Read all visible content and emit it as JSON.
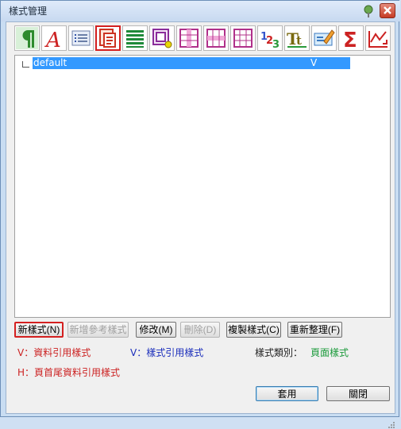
{
  "window": {
    "title": "樣式管理"
  },
  "colors": {
    "red": "#cc2222",
    "blue": "#1a2dbb",
    "green": "#1a9a3a",
    "selection": "#3399ff"
  },
  "toolbar": {
    "icons": [
      "pilcrow-icon",
      "text-style-icon",
      "list-style-icon",
      "page-style-icon",
      "rows-style-icon",
      "frame-style-icon",
      "column-style-icon",
      "row-band-icon",
      "grid-style-icon",
      "number-style-icon",
      "font-style-icon",
      "edit-style-icon",
      "sum-style-icon",
      "chart-style-icon"
    ],
    "selected_index": 3
  },
  "tree": {
    "item_name": "default",
    "item_flag": "V"
  },
  "buttons": {
    "new_style": "新樣式(N)",
    "new_ref_style": "新增參考樣式",
    "modify": "修改(M)",
    "delete": "刪除(D)",
    "copy_style": "複製樣式(C)",
    "reorganize": "重新整理(F)",
    "apply": "套用",
    "close": "關閉"
  },
  "legend": {
    "data_ref": "V：資料引用樣式",
    "style_ref": "V：樣式引用樣式",
    "category_label": "樣式類別：",
    "category_value": "頁面樣式",
    "header_ref": "H：頁首尾資料引用樣式"
  }
}
